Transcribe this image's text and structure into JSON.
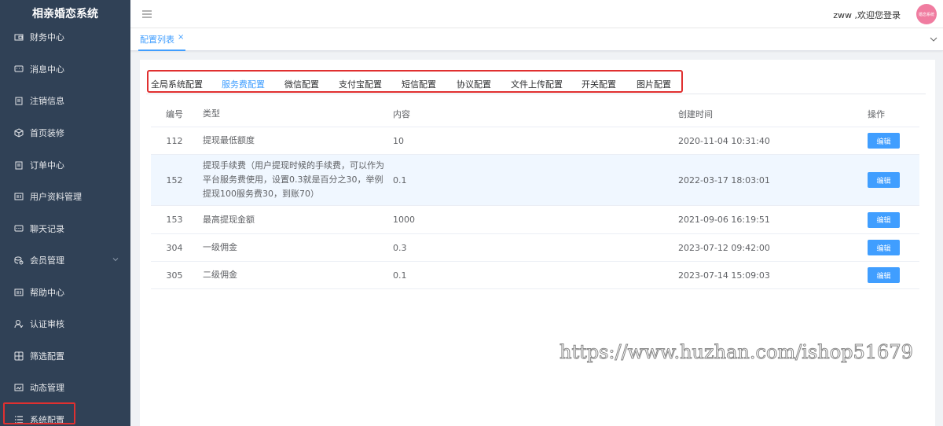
{
  "app": {
    "title": "相亲婚恋系统"
  },
  "sidebar": {
    "items": [
      {
        "label": "财务中心",
        "icon": "wallet-icon"
      },
      {
        "label": "消息中心",
        "icon": "message-icon"
      },
      {
        "label": "注销信息",
        "icon": "clipboard-icon"
      },
      {
        "label": "首页装修",
        "icon": "cube-icon"
      },
      {
        "label": "订单中心",
        "icon": "clipboard-icon"
      },
      {
        "label": "用户资料管理",
        "icon": "idcard-icon"
      },
      {
        "label": "聊天记录",
        "icon": "chat-icon"
      },
      {
        "label": "会员管理",
        "icon": "coins-icon"
      },
      {
        "label": "帮助中心",
        "icon": "idcard-icon"
      },
      {
        "label": "认证审核",
        "icon": "user-icon"
      },
      {
        "label": "筛选配置",
        "icon": "grid-icon"
      },
      {
        "label": "动态管理",
        "icon": "image-icon"
      },
      {
        "label": "系统配置",
        "icon": "list-icon"
      }
    ]
  },
  "header": {
    "welcome": "zww ,欢迎您登录",
    "avatar_text": "婚恋系统"
  },
  "tabs": {
    "active": {
      "label": "配置列表",
      "close": "×"
    }
  },
  "config_tabs": [
    {
      "label": "全局系统配置",
      "active": false
    },
    {
      "label": "服务费配置",
      "active": true
    },
    {
      "label": "微信配置",
      "active": false
    },
    {
      "label": "支付宝配置",
      "active": false
    },
    {
      "label": "短信配置",
      "active": false
    },
    {
      "label": "协议配置",
      "active": false
    },
    {
      "label": "文件上传配置",
      "active": false
    },
    {
      "label": "开关配置",
      "active": false
    },
    {
      "label": "图片配置",
      "active": false
    }
  ],
  "table": {
    "headers": {
      "id": "编号",
      "type": "类型",
      "content": "内容",
      "created": "创建时间",
      "action": "操作"
    },
    "rows": [
      {
        "id": "112",
        "type": "提现最低额度",
        "content": "10",
        "created": "2020-11-04 10:31:40",
        "action": "编辑"
      },
      {
        "id": "152",
        "type": "提现手续费（用户提现时候的手续费，可以作为平台服务费使用，设置0.3就是百分之30，举例提现100服务费30，到账70）",
        "content": "0.1",
        "created": "2022-03-17 18:03:01",
        "action": "编辑"
      },
      {
        "id": "153",
        "type": "最高提现金额",
        "content": "1000",
        "created": "2021-09-06 16:19:51",
        "action": "编辑"
      },
      {
        "id": "304",
        "type": "一级佣金",
        "content": "0.3",
        "created": "2023-07-12 09:42:00",
        "action": "编辑"
      },
      {
        "id": "305",
        "type": "二级佣金",
        "content": "0.1",
        "created": "2023-07-14 15:09:03",
        "action": "编辑"
      }
    ]
  },
  "watermark": "https://www.huzhan.com/ishop51679",
  "colors": {
    "sidebar_bg": "#304156",
    "accent": "#409eff",
    "highlight": "#e03030"
  }
}
